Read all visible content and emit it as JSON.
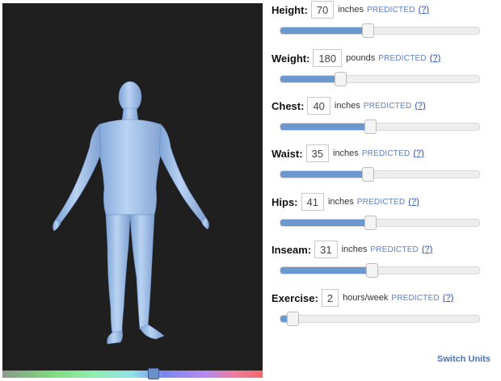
{
  "viewer": {
    "color_strip_level": 0.58
  },
  "measurements": [
    {
      "label": "Height:",
      "value": "70",
      "unit": "inches",
      "predicted": "PREDICTED",
      "help": "(?)",
      "level": 0.44
    },
    {
      "label": "Weight:",
      "value": "180",
      "unit": "pounds",
      "predicted": "PREDICTED",
      "help": "(?)",
      "level": 0.3
    },
    {
      "label": "Chest:",
      "value": "40",
      "unit": "inches",
      "predicted": "PREDICTED",
      "help": "(?)",
      "level": 0.45
    },
    {
      "label": "Waist:",
      "value": "35",
      "unit": "inches",
      "predicted": "PREDICTED",
      "help": "(?)",
      "level": 0.44
    },
    {
      "label": "Hips:",
      "value": "41",
      "unit": "inches",
      "predicted": "PREDICTED",
      "help": "(?)",
      "level": 0.45
    },
    {
      "label": "Inseam:",
      "value": "31",
      "unit": "inches",
      "predicted": "PREDICTED",
      "help": "(?)",
      "level": 0.46
    },
    {
      "label": "Exercise:",
      "value": "2",
      "unit": "hours/week",
      "predicted": "PREDICTED",
      "help": "(?)",
      "level": 0.06
    }
  ],
  "switch_units": "Switch Units",
  "colors": {
    "accent": "#6a98cf",
    "link": "#2a4fb0",
    "predicted": "#5b7fc4",
    "viewer_bg": "#1f1f1f",
    "body_color": "#9fc0ea"
  }
}
